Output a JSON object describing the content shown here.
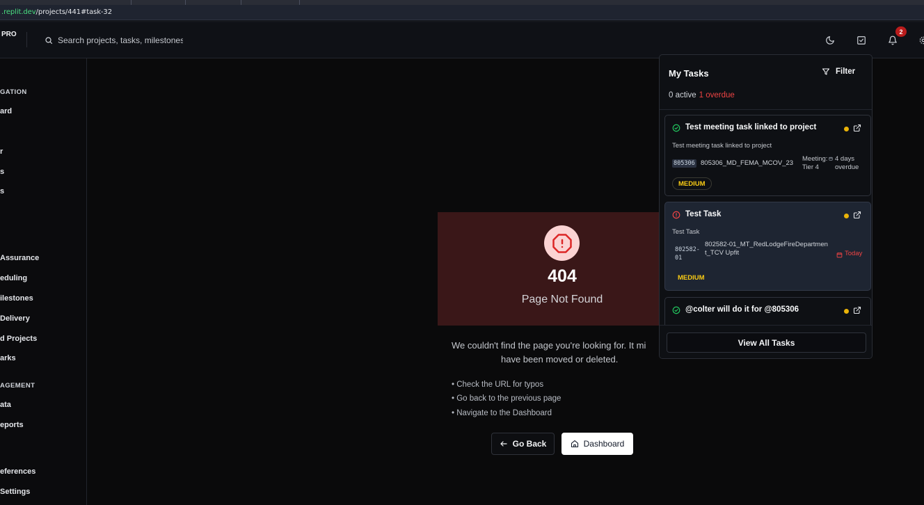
{
  "browser": {
    "url_host": ".replit.dev",
    "url_path": "/projects/441#task-32"
  },
  "header": {
    "brand_fragment": "PRO",
    "search_placeholder": "Search projects, tasks, milestones",
    "notification_count": "2",
    "icons": [
      "search-icon",
      "moon-icon",
      "check-square-icon",
      "bell-icon",
      "gear-icon"
    ]
  },
  "sidebar": {
    "items": [
      {
        "label": "GATION",
        "kind": "section"
      },
      {
        "label": "ard",
        "kind": "item"
      },
      {
        "label": "r",
        "kind": "item"
      },
      {
        "label": "s",
        "kind": "item"
      },
      {
        "label": "s",
        "kind": "item"
      },
      {
        "label": "Assurance",
        "kind": "item"
      },
      {
        "label": "eduling",
        "kind": "item"
      },
      {
        "label": "ilestones",
        "kind": "item"
      },
      {
        "label": "Delivery",
        "kind": "item"
      },
      {
        "label": "d Projects",
        "kind": "item"
      },
      {
        "label": "arks",
        "kind": "item"
      },
      {
        "label": "AGEMENT",
        "kind": "section"
      },
      {
        "label": "ata",
        "kind": "item"
      },
      {
        "label": "eports",
        "kind": "item"
      },
      {
        "label": "eferences",
        "kind": "item"
      },
      {
        "label": "Settings",
        "kind": "item"
      }
    ]
  },
  "not_found": {
    "code": "404",
    "title": "Page Not Found",
    "message_line1": "We couldn't find the page you're looking for. It mi",
    "message_line2": "have been moved or deleted.",
    "tips": [
      "• Check the URL for typos",
      "• Go back to the previous page",
      "• Navigate to the Dashboard"
    ],
    "back_label": "Go Back",
    "dashboard_label": "Dashboard",
    "colors": {
      "banner_bg": "#3a1718",
      "icon_bg": "#fbd3d3",
      "icon_stroke": "#dc2626"
    }
  },
  "tasks_panel": {
    "title": "My Tasks",
    "filter_label": "Filter",
    "active_text": "0 active",
    "overdue_text": "1 overdue",
    "tasks": [
      {
        "title": "Test meeting task linked to project",
        "status": "done",
        "description": "Test meeting task linked to project",
        "code": "805306",
        "project": "805306_MD_FEMA_MCOV_23",
        "meeting": "Meeting: Tier 4",
        "due": "4 days overdue",
        "priority": "MEDIUM"
      },
      {
        "title": "Test Task",
        "status": "alert",
        "description": "Test Task",
        "code": "802582-01",
        "project": "802582-01_MT_RedLodgeFireDepartment_TCV Upfit",
        "due": "Today",
        "priority": "MEDIUM"
      },
      {
        "title": "@colter will do it for @805306",
        "status": "done"
      }
    ],
    "view_all_label": "View All Tasks",
    "colors": {
      "priority_dot": "#eab308",
      "overdue": "#ef4444",
      "highlight_bg": "#1e2532"
    }
  }
}
